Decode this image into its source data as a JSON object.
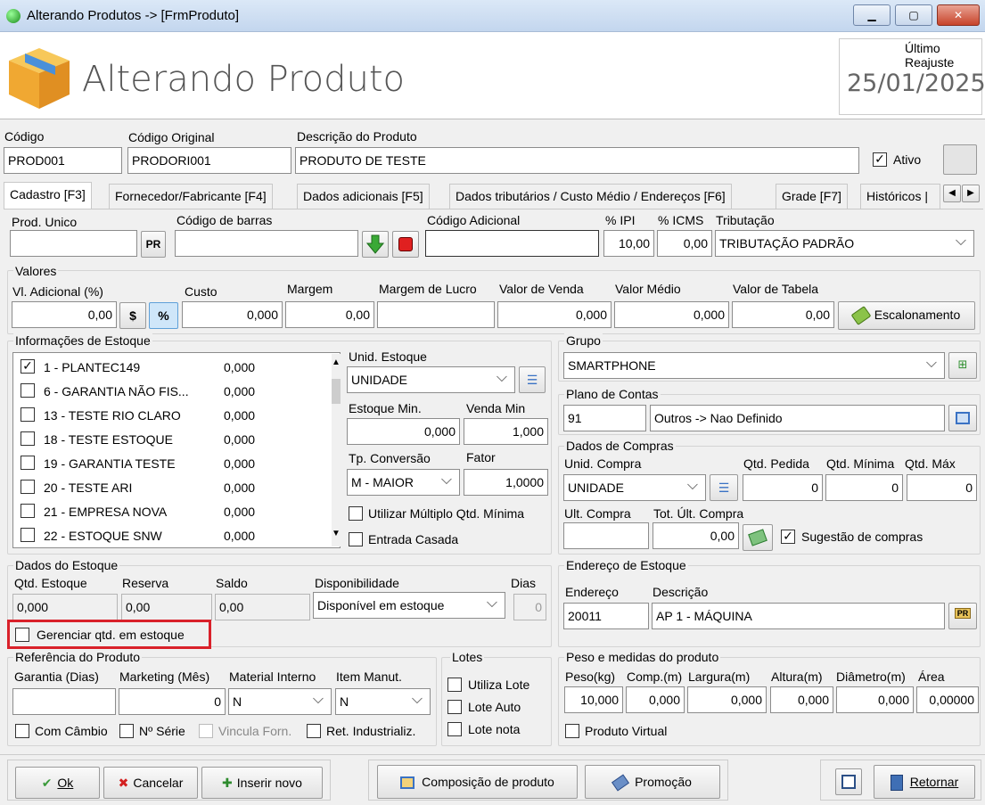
{
  "window": {
    "title": "Alterando Produtos  ->  [FrmProduto]",
    "min_icon": "minimize-icon",
    "max_icon": "maximize-icon",
    "close_label": "✕"
  },
  "header": {
    "title": "Alterando Produto",
    "reajuste_label": "Último Reajuste",
    "reajuste_value": "25/01/2025"
  },
  "top_fields": {
    "codigo_label": "Código",
    "codigo": "PROD001",
    "codigo_original_label": "Código Original",
    "codigo_original": "PRODORI001",
    "descricao_label": "Descrição do Produto",
    "descricao": "PRODUTO DE TESTE",
    "ativo_label": "Ativo",
    "ativo_checked": "✓"
  },
  "tabs": [
    {
      "label": "Cadastro [F3]"
    },
    {
      "label": "Fornecedor/Fabricante [F4]"
    },
    {
      "label": "Dados adicionais [F5]"
    },
    {
      "label": "Dados tributários / Custo Médio / Endereços [F6]"
    },
    {
      "label": "Grade [F7]"
    },
    {
      "label": "Históricos |"
    }
  ],
  "row1": {
    "prod_unico_label": "Prod. Unico",
    "pr_button": "PR",
    "codigo_barras_label": "Código de barras",
    "codigo_adicional_label": "Código Adicional",
    "ipi_label": "% IPI",
    "ipi": "10,00",
    "icms_label": "% ICMS",
    "icms": "0,00",
    "tributacao_label": "Tributação",
    "tributacao": "TRIBUTAÇÃO PADRÃO"
  },
  "valores": {
    "group_label": "Valores",
    "vl_adicional_label": "Vl. Adicional (%)",
    "vl_adicional": "0,00",
    "btn_dollar": "$",
    "btn_percent": "%",
    "custo_label": "Custo",
    "custo": "0,000",
    "margem_label": "Margem",
    "margem": "0,00",
    "margem_lucro_label": "Margem de Lucro",
    "valor_venda_label": "Valor de Venda",
    "valor_venda": "0,000",
    "valor_medio_label": "Valor Médio",
    "valor_medio": "0,000",
    "valor_tabela_label": "Valor de Tabela",
    "valor_tabela": "0,00",
    "escalonamento": "Escalonamento"
  },
  "estoque_info": {
    "group_label": "Informações de Estoque",
    "items": [
      {
        "name": "1 - PLANTEC149",
        "qty": "0,000",
        "check": "✓"
      },
      {
        "name": "6 - GARANTIA NÃO FIS...",
        "qty": "0,000",
        "check": ""
      },
      {
        "name": "13 - TESTE RIO CLARO",
        "qty": "0,000",
        "check": ""
      },
      {
        "name": "18 - TESTE ESTOQUE",
        "qty": "0,000",
        "check": ""
      },
      {
        "name": "19 - GARANTIA TESTE",
        "qty": "0,000",
        "check": ""
      },
      {
        "name": "20 - TESTE ARI",
        "qty": "0,000",
        "check": ""
      },
      {
        "name": "21 - EMPRESA NOVA",
        "qty": "0,000",
        "check": ""
      },
      {
        "name": "22 - ESTOQUE SNW",
        "qty": "0,000",
        "check": ""
      }
    ],
    "unid_estoque_label": "Unid. Estoque",
    "unid_estoque": "UNIDADE",
    "estoque_min_label": "Estoque Min.",
    "estoque_min": "0,000",
    "venda_min_label": "Venda Min",
    "venda_min": "1,000",
    "tp_conversao_label": "Tp. Conversão",
    "tp_conversao": "M - MAIOR",
    "fator_label": "Fator",
    "fator": "1,0000",
    "multiplo_label": "Utilizar Múltiplo Qtd. Mínima",
    "entrada_casada_label": "Entrada Casada"
  },
  "grupo": {
    "group_label": "Grupo",
    "value": "SMARTPHONE"
  },
  "plano_contas": {
    "group_label": "Plano de Contas",
    "codigo": "91",
    "descricao": "Outros -> Nao Definido"
  },
  "compras": {
    "group_label": "Dados de Compras",
    "unid_compra_label": "Unid. Compra",
    "unid_compra": "UNIDADE",
    "qtd_pedida_label": "Qtd. Pedida",
    "qtd_pedida": "0",
    "qtd_minima_label": "Qtd. Mínima",
    "qtd_minima": "0",
    "qtd_max_label": "Qtd. Máx",
    "qtd_max": "0",
    "ult_compra_label": "Ult. Compra",
    "tot_ult_compra_label": "Tot. Últ. Compra",
    "tot_ult_compra": "0,00",
    "sugestao_label": "Sugestão de compras",
    "sugestao_checked": "✓"
  },
  "dados_estoque": {
    "group_label": "Dados do Estoque",
    "qtd_label": "Qtd. Estoque",
    "qtd": "0,000",
    "reserva_label": "Reserva",
    "reserva": "0,00",
    "saldo_label": "Saldo",
    "saldo": "0,00",
    "disp_label": "Disponibilidade",
    "disp": "Disponível em estoque",
    "dias_label": "Dias",
    "dias": "0",
    "gerenciar_label": "Gerenciar qtd. em estoque"
  },
  "endereco": {
    "group_label": "Endereço de Estoque",
    "endereco_label": "Endereço",
    "endereco": "20011",
    "descricao_label": "Descrição",
    "descricao": "AP 1 - MÁQUINA"
  },
  "referencia": {
    "group_label": "Referência do Produto",
    "garantia_label": "Garantia (Dias)",
    "marketing_label": "Marketing (Mês)",
    "marketing": "0",
    "material_label": "Material Interno",
    "material": "N",
    "item_manut_label": "Item Manut.",
    "item_manut": "N",
    "com_cambio": "Com Câmbio",
    "n_serie": "Nº Série",
    "vincula": "Vincula Forn.",
    "ret_ind": "Ret. Industrializ."
  },
  "lotes": {
    "group_label": "Lotes",
    "utiliza": "Utiliza Lote",
    "auto": "Lote Auto",
    "nota": "Lote nota"
  },
  "peso": {
    "group_label": "Peso e medidas do produto",
    "peso_label": "Peso(kg)",
    "peso": "10,000",
    "comp_label": "Comp.(m)",
    "comp": "0,000",
    "largura_label": "Largura(m)",
    "largura": "0,000",
    "altura_label": "Altura(m)",
    "altura": "0,000",
    "diametro_label": "Diâmetro(m)",
    "diametro": "0,000",
    "area_label": "Área",
    "area": "0,00000",
    "virtual_label": "Produto Virtual"
  },
  "footer": {
    "ok": "Ok",
    "cancelar": "Cancelar",
    "inserir": "Inserir novo",
    "composicao": "Composição de produto",
    "promocao": "Promoção",
    "retornar": "Retornar"
  }
}
